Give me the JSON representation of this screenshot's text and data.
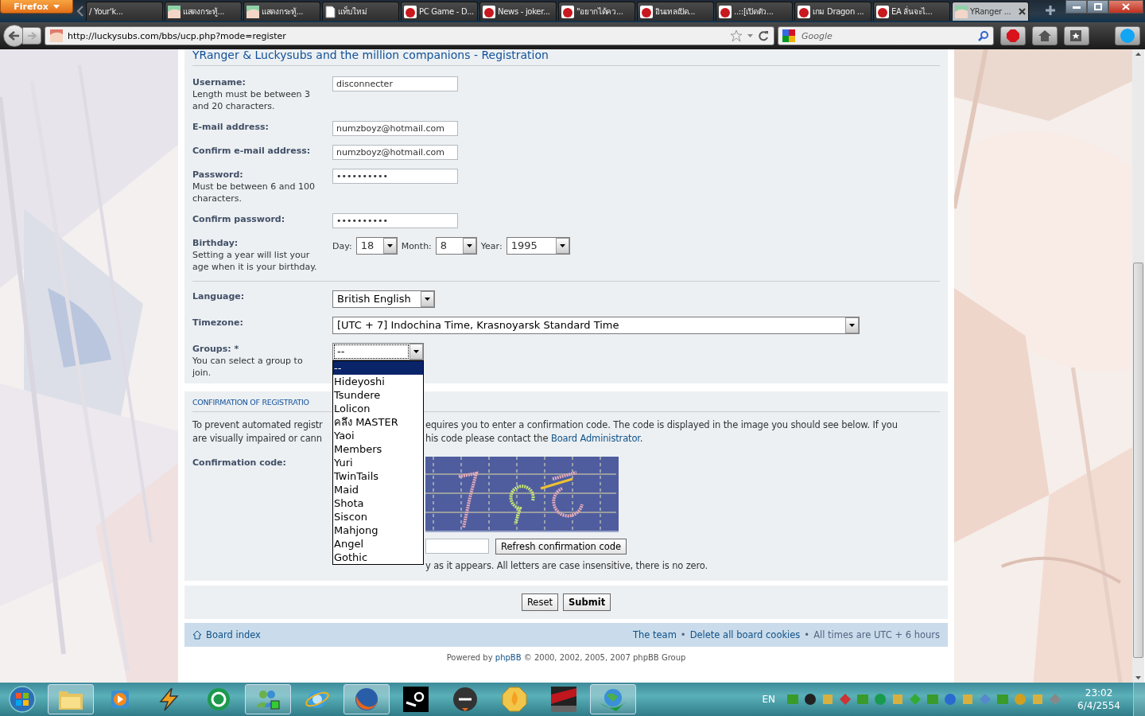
{
  "browser": {
    "menu_button": "Firefox",
    "tabs": [
      {
        "title": "/ Your'k...",
        "selected": false
      },
      {
        "title": "แสดงกระทู้...",
        "selected": false
      },
      {
        "title": "แสดงกระทู้...",
        "selected": false
      },
      {
        "title": "แท็บใหม่",
        "selected": false
      },
      {
        "title": "PC Game - D...",
        "selected": false
      },
      {
        "title": "News - joker...",
        "selected": false
      },
      {
        "title": "\"อยากได้คว...",
        "selected": false
      },
      {
        "title": "อินเทลเปิด...",
        "selected": false
      },
      {
        "title": "..::[เปิดตัว...",
        "selected": false
      },
      {
        "title": "เกม Dragon ...",
        "selected": false
      },
      {
        "title": "EA ลั่นจะไ...",
        "selected": false
      },
      {
        "title": "YRanger ...",
        "selected": true
      }
    ],
    "address": "http://luckysubs.com/bbs/ucp.php?mode=register",
    "search": {
      "placeholder": "Google"
    }
  },
  "page": {
    "title": "YRanger & Luckysubs and the million companions - Registration",
    "account_fields": [
      {
        "kind": "text",
        "label": "Username:",
        "hint": "Length must be between 3 and 20 characters.",
        "value": "disconnecter"
      },
      {
        "kind": "text",
        "label": "E-mail address:",
        "value": "numzboyz@hotmail.com"
      },
      {
        "kind": "text",
        "label": "Confirm e-mail address:",
        "value": "numzboyz@hotmail.com"
      },
      {
        "kind": "text",
        "label": "Password:",
        "hint": "Must be between 6 and 100 characters.",
        "value": "••••••••••"
      },
      {
        "kind": "text",
        "label": "Confirm password:",
        "value": "••••••••••"
      },
      {
        "kind": "date",
        "label": "Birthday:",
        "hint": "Setting a year will list your age when it is your birthday.",
        "parts": [
          {
            "label": "Day:",
            "value": "18"
          },
          {
            "label": "Month:",
            "value": "8"
          },
          {
            "label": "Year:",
            "value": "1995"
          }
        ]
      }
    ],
    "profile_fields": [
      {
        "kind": "select",
        "label": "Language:",
        "value": "British English",
        "wide": false
      },
      {
        "kind": "select",
        "label": "Timezone:",
        "value": "[UTC + 7] Indochina Time, Krasnoyarsk Standard Time",
        "wide": true
      }
    ],
    "groups": {
      "label": "Groups:",
      "mark": "*",
      "hint": "You can select a group to join.",
      "value": "--",
      "expanded": true,
      "options": [
        {
          "label": "--",
          "selected": true
        },
        {
          "label": "Hideyoshi",
          "selected": false
        },
        {
          "label": "Tsundere",
          "selected": false
        },
        {
          "label": "Lolicon",
          "selected": false
        },
        {
          "label": "คลึง MASTER",
          "selected": false
        },
        {
          "label": "Yaoi",
          "selected": false
        },
        {
          "label": "Members",
          "selected": false
        },
        {
          "label": "Yuri",
          "selected": false
        },
        {
          "label": "TwinTails",
          "selected": false
        },
        {
          "label": "Maid",
          "selected": false
        },
        {
          "label": "Shota",
          "selected": false
        },
        {
          "label": "Siscon",
          "selected": false
        },
        {
          "label": "Mahjong",
          "selected": false
        },
        {
          "label": "Angel",
          "selected": false
        },
        {
          "label": "Gothic",
          "selected": false
        }
      ]
    },
    "confirmation": {
      "heading": "CONFIRMATION OF REGISTRATIO",
      "intro_left": [
        "To prevent automated registr",
        "are visually impaired or cann"
      ],
      "intro_right": "equires you to enter a confirmation code. The code is displayed in the image you should see below. If you",
      "intro_right_2": {
        "before": "his code please contact the ",
        "link": "Board Administrator",
        "after": "."
      },
      "code_label": "Confirmation code:",
      "refresh_button": "Refresh confirmation code",
      "code_hint": "y as it appears. All letters are case insensitive, there is no zero."
    },
    "buttons": [
      {
        "label": "Reset",
        "primary": false
      },
      {
        "label": "Submit",
        "primary": true
      }
    ],
    "footer": {
      "home_link": "Board index",
      "items": [
        {
          "kind": "link",
          "text": "The team"
        },
        {
          "kind": "bullet",
          "text": "•"
        },
        {
          "kind": "link",
          "text": "Delete all board cookies"
        },
        {
          "kind": "bullet",
          "text": "•"
        },
        {
          "kind": "text",
          "text": "All times are UTC + 6 hours"
        }
      ]
    },
    "powered": {
      "before": "Powered by ",
      "link": "phpBB",
      "after": " © 2000, 2002, 2005, 2007 phpBB Group"
    }
  },
  "taskbar": {
    "buttons": [
      {
        "running": true
      },
      {
        "running": false
      },
      {
        "running": false
      },
      {
        "running": false
      },
      {
        "running": true
      },
      {
        "running": false
      },
      {
        "running": true
      },
      {
        "running": false
      },
      {
        "running": false
      },
      {
        "running": false
      },
      {
        "running": false
      },
      {
        "running": true
      }
    ],
    "language": "EN",
    "time": "23:02",
    "date": "6/4/2554"
  }
}
